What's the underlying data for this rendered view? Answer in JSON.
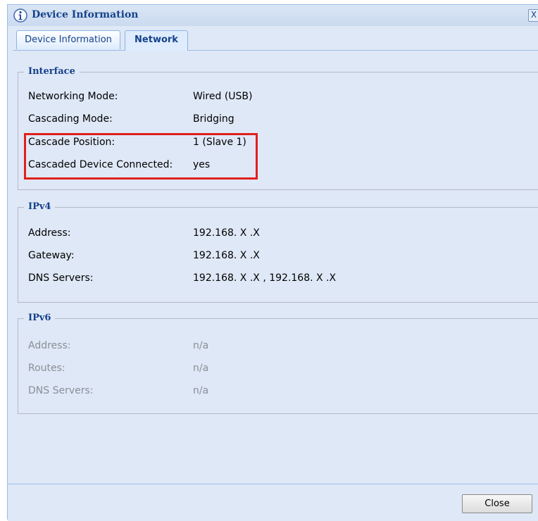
{
  "window": {
    "title": "Device Information",
    "close_glyph": "X"
  },
  "tabs": [
    {
      "label": "Device Information",
      "active": false
    },
    {
      "label": "Network",
      "active": true
    }
  ],
  "interface": {
    "legend": "Interface",
    "rows": [
      {
        "label": "Networking Mode:",
        "value": "Wired (USB)"
      },
      {
        "label": "Cascading Mode:",
        "value": "Bridging"
      },
      {
        "label": "Cascade Position:",
        "value": "1 (Slave 1)"
      },
      {
        "label": "Cascaded Device Connected:",
        "value": "yes"
      }
    ]
  },
  "ipv4": {
    "legend": "IPv4",
    "rows": [
      {
        "label": "Address:",
        "value": "192.168. X .X"
      },
      {
        "label": "Gateway:",
        "value": "192.168. X .X"
      },
      {
        "label": "DNS Servers:",
        "value": "192.168. X .X , 192.168. X .X"
      }
    ]
  },
  "ipv6": {
    "legend": "IPv6",
    "rows": [
      {
        "label": "Address:",
        "value": "n/a"
      },
      {
        "label": "Routes:",
        "value": "n/a"
      },
      {
        "label": "DNS Servers:",
        "value": "n/a"
      }
    ]
  },
  "footer": {
    "close_label": "Close"
  },
  "colors": {
    "highlight": "#e0201c",
    "title": "#15428b",
    "background": "#dfe8f6"
  },
  "icons": {
    "title_icon": "info-icon"
  }
}
